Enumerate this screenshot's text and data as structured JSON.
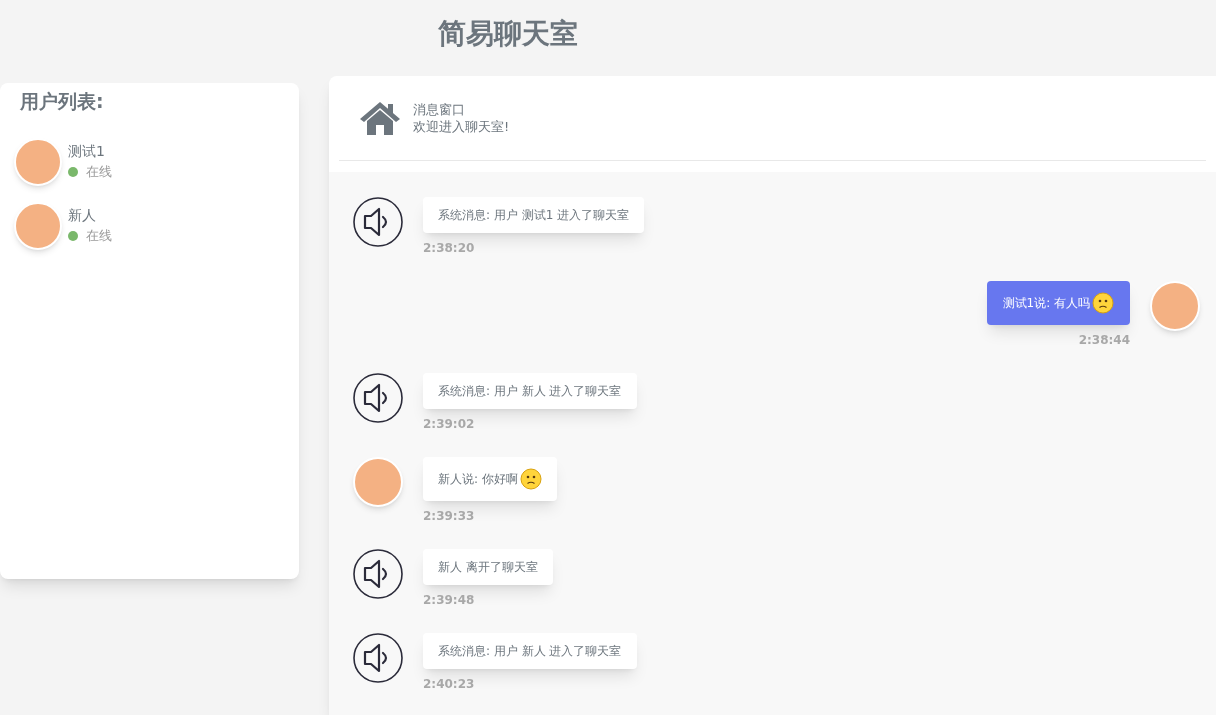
{
  "title": "简易聊天室",
  "user_list": {
    "heading": "用户列表:",
    "users": [
      {
        "name": "测试1",
        "status": "在线"
      },
      {
        "name": "新人",
        "status": "在线"
      }
    ]
  },
  "chat_header": {
    "title": "消息窗口",
    "subtitle": "欢迎进入聊天室!"
  },
  "messages": [
    {
      "kind": "system",
      "text": "系统消息:  用户 测试1 进入了聊天室",
      "time": "2:38:20",
      "emoji": false
    },
    {
      "kind": "self",
      "text": "测试1说: 有人吗",
      "time": "2:38:44",
      "emoji": true
    },
    {
      "kind": "system",
      "text": "系统消息:  用户 新人 进入了聊天室",
      "time": "2:39:02",
      "emoji": false
    },
    {
      "kind": "other",
      "text": "新人说: 你好啊",
      "time": "2:39:33",
      "emoji": true
    },
    {
      "kind": "system",
      "text": "新人 离开了聊天室",
      "time": "2:39:48",
      "emoji": false
    },
    {
      "kind": "system",
      "text": "系统消息:  用户 新人 进入了聊天室",
      "time": "2:40:23",
      "emoji": false
    }
  ]
}
